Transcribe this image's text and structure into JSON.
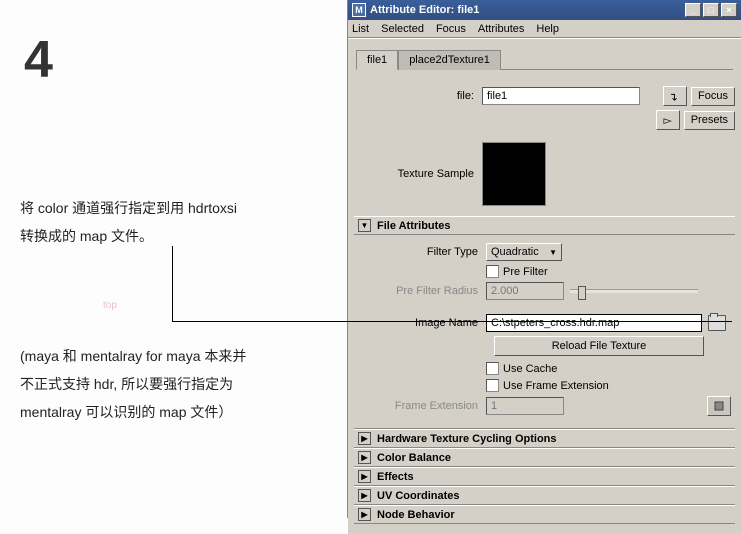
{
  "left": {
    "step_number": "4",
    "text1_line1": "将 color 通道强行指定到用 hdrtoxsi",
    "text1_line2": "转换成的 map 文件。",
    "text2_line1": "(maya 和 mentalray for maya 本来并",
    "text2_line2": "不正式支持 hdr, 所以要强行指定为",
    "text2_line3": "mentalray 可以识别的 map 文件）",
    "viewport_label": "top"
  },
  "window": {
    "title": "Attribute Editor: file1",
    "icon_letter": "M"
  },
  "menu": {
    "list": "List",
    "selected": "Selected",
    "focus": "Focus",
    "attributes": "Attributes",
    "help": "Help"
  },
  "tabs": {
    "t1": "file1",
    "t2": "place2dTexture1"
  },
  "header_row": {
    "label": "file:",
    "value": "file1",
    "btn_focus": "Focus",
    "btn_presets": "Presets"
  },
  "texture_sample_label": "Texture Sample",
  "sections": {
    "file_attributes": "File Attributes",
    "hw_texture": "Hardware Texture Cycling Options",
    "color_balance": "Color Balance",
    "effects": "Effects",
    "uv_coords": "UV Coordinates",
    "node_behavior": "Node Behavior"
  },
  "file_attrs": {
    "filter_type_label": "Filter Type",
    "filter_type_value": "Quadratic",
    "pre_filter_label": "Pre Filter",
    "pre_filter_radius_label": "Pre Filter Radius",
    "pre_filter_radius_value": "2.000",
    "image_name_label": "Image Name",
    "image_name_value": "C:\\stpeters_cross.hdr.map",
    "reload_btn": "Reload File Texture",
    "use_cache_label": "Use Cache",
    "use_frame_ext_label": "Use Frame Extension",
    "frame_ext_label": "Frame Extension",
    "frame_ext_value": "1"
  },
  "glyphs": {
    "triangle_down": "▼",
    "triangle_right": "▶",
    "arrow_back": "↵",
    "arrow_fwd": "▻",
    "min": "_",
    "max": "□",
    "close": "×"
  }
}
